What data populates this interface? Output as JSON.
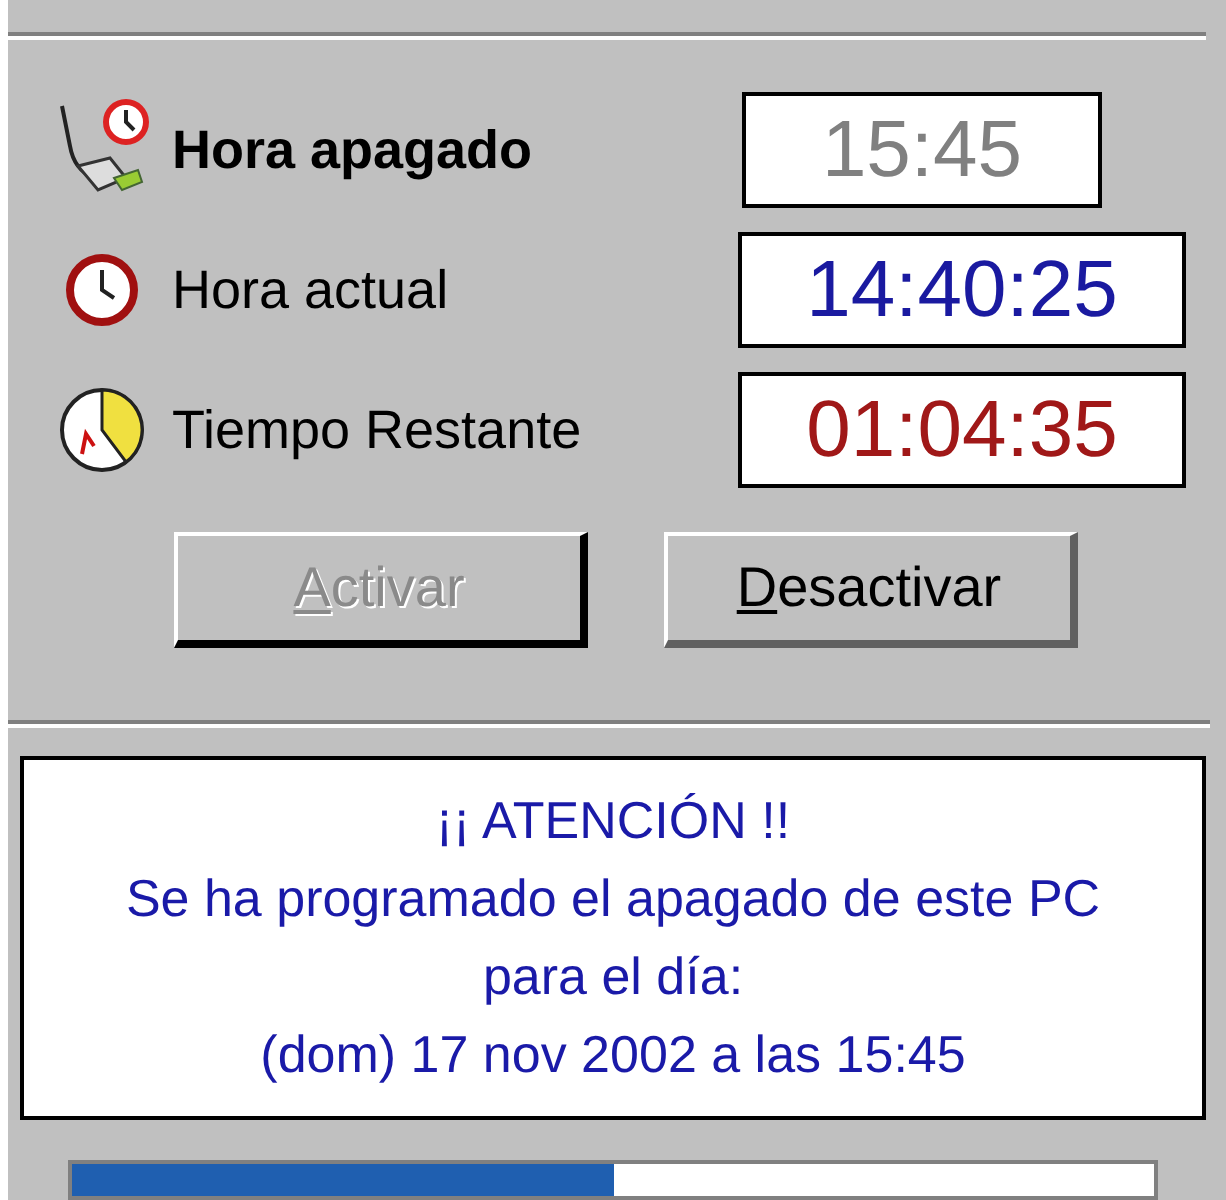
{
  "fields": [
    {
      "kind": "shutdown",
      "label": "Hora apagado",
      "bold": true,
      "value": "15:45",
      "color": "#808080"
    },
    {
      "kind": "clock",
      "label": "Hora actual",
      "bold": false,
      "value": "14:40:25",
      "color": "#1a1aa0"
    },
    {
      "kind": "timer",
      "label": "Tiempo Restante",
      "bold": false,
      "value": "01:04:35",
      "color": "#a01818"
    }
  ],
  "buttons": [
    {
      "label": "Activar",
      "disabled": true,
      "mnemonic": true
    },
    {
      "label": "Desactivar",
      "disabled": false,
      "mnemonic": true
    }
  ],
  "message": [
    "¡¡ ATENCIÓN !!",
    "Se ha programado el apagado de este PC",
    "para el día:",
    "(dom) 17 nov 2002 a las 15:45"
  ],
  "progress": {
    "level": 0.5
  }
}
